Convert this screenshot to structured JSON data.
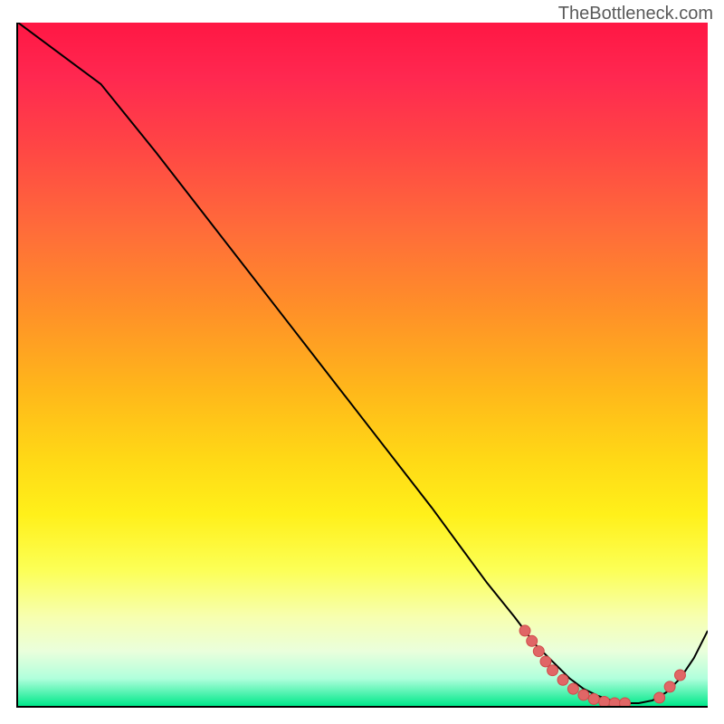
{
  "watermark": "TheBottleneck.com",
  "chart_data": {
    "type": "line",
    "title": "",
    "xlabel": "",
    "ylabel": "",
    "xlim": [
      0,
      100
    ],
    "ylim": [
      0,
      100
    ],
    "series": [
      {
        "name": "curve",
        "x": [
          0,
          4,
          8,
          12,
          20,
          30,
          40,
          50,
          60,
          68,
          72,
          75,
          78,
          80,
          82,
          84,
          86,
          88,
          90,
          92,
          94,
          96,
          98,
          100
        ],
        "y": [
          100,
          97,
          94,
          91,
          81,
          68,
          55,
          42,
          29,
          18,
          13,
          9,
          6,
          4,
          2.5,
          1.5,
          0.8,
          0.4,
          0.4,
          0.8,
          2,
          4,
          7,
          11
        ]
      }
    ],
    "markers": [
      {
        "x": 73.5,
        "y": 11.0
      },
      {
        "x": 74.5,
        "y": 9.5
      },
      {
        "x": 75.5,
        "y": 8.0
      },
      {
        "x": 76.5,
        "y": 6.5
      },
      {
        "x": 77.5,
        "y": 5.2
      },
      {
        "x": 79.0,
        "y": 3.8
      },
      {
        "x": 80.5,
        "y": 2.5
      },
      {
        "x": 82.0,
        "y": 1.6
      },
      {
        "x": 83.5,
        "y": 1.0
      },
      {
        "x": 85.0,
        "y": 0.6
      },
      {
        "x": 86.5,
        "y": 0.4
      },
      {
        "x": 88.0,
        "y": 0.4
      },
      {
        "x": 93.0,
        "y": 1.2
      },
      {
        "x": 94.5,
        "y": 2.8
      },
      {
        "x": 96.0,
        "y": 4.5
      }
    ],
    "gradient_stops": [
      {
        "pos": 0,
        "color": "#ff1744"
      },
      {
        "pos": 50,
        "color": "#ffb81a"
      },
      {
        "pos": 80,
        "color": "#fcff55"
      },
      {
        "pos": 100,
        "color": "#00e88a"
      }
    ]
  }
}
